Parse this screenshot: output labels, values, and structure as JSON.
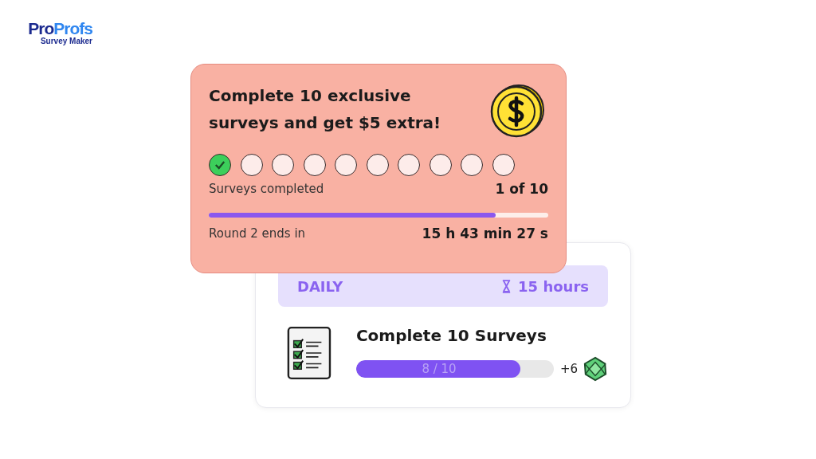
{
  "logo": {
    "part_1": "Pro",
    "part_2": "Profs",
    "tagline": "Survey Maker"
  },
  "reward_card": {
    "title": "Complete 10 exclusive surveys and get $5 extra!",
    "steps": [
      {
        "checked": true
      },
      {
        "checked": false
      },
      {
        "checked": false
      },
      {
        "checked": false
      },
      {
        "checked": false
      },
      {
        "checked": false
      },
      {
        "checked": false
      },
      {
        "checked": false
      },
      {
        "checked": false
      },
      {
        "checked": false
      }
    ],
    "progress_label": "Surveys completed",
    "progress_count": "1 of 10",
    "timer": {
      "level": 0.845
    },
    "round_label": "Round 2 ends in",
    "round_time": "15 h 43 min 27 s"
  },
  "daily_card": {
    "period": "DAILY",
    "time_left": "15 hours",
    "task": "Complete 10 Surveys",
    "progress": {
      "level": 0.83,
      "reading": "8 / 10"
    },
    "reward": "+6"
  }
}
